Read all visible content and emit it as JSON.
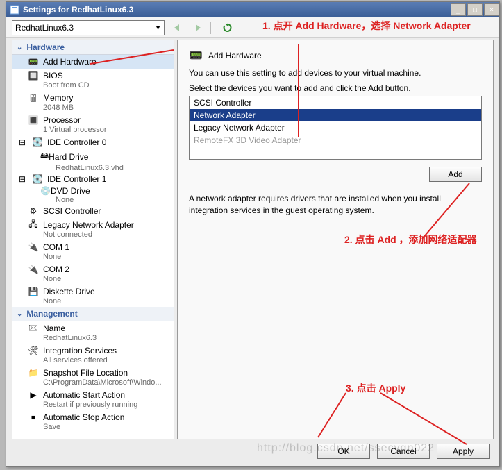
{
  "window": {
    "title": "Settings for RedhatLinux6.3"
  },
  "toolbar": {
    "vm_name": "RedhatLinux6.3"
  },
  "sections": {
    "hardware": "Hardware",
    "management": "Management"
  },
  "hw": {
    "add": {
      "label": "Add Hardware"
    },
    "bios": {
      "label": "BIOS",
      "sub": "Boot from CD"
    },
    "memory": {
      "label": "Memory",
      "sub": "2048 MB"
    },
    "processor": {
      "label": "Processor",
      "sub": "1 Virtual processor"
    },
    "ide0": {
      "label": "IDE Controller 0",
      "child": {
        "label": "Hard Drive",
        "sub": "RedhatLinux6.3.vhd"
      }
    },
    "ide1": {
      "label": "IDE Controller 1",
      "child": {
        "label": "DVD Drive",
        "sub": "None"
      }
    },
    "scsi": {
      "label": "SCSI Controller"
    },
    "legacy": {
      "label": "Legacy Network Adapter",
      "sub": "Not connected"
    },
    "com1": {
      "label": "COM 1",
      "sub": "None"
    },
    "com2": {
      "label": "COM 2",
      "sub": "None"
    },
    "diskette": {
      "label": "Diskette Drive",
      "sub": "None"
    }
  },
  "mg": {
    "name": {
      "label": "Name",
      "sub": "RedhatLinux6.3"
    },
    "integ": {
      "label": "Integration Services",
      "sub": "All services offered"
    },
    "snap": {
      "label": "Snapshot File Location",
      "sub": "C:\\ProgramData\\Microsoft\\Windo..."
    },
    "astart": {
      "label": "Automatic Start Action",
      "sub": "Restart if previously running"
    },
    "astop": {
      "label": "Automatic Stop Action",
      "sub": "Save"
    }
  },
  "main": {
    "title": "Add Hardware",
    "desc1": "You can use this setting to add devices to your virtual machine.",
    "desc2": "Select the devices you want to add and click the Add button.",
    "devices": {
      "d0": "SCSI Controller",
      "d1": "Network Adapter",
      "d2": "Legacy Network Adapter",
      "d3": "RemoteFX 3D Video Adapter"
    },
    "add_btn": "Add",
    "info": "A network adapter requires drivers that are installed when you install integration services in the guest operating system."
  },
  "footer": {
    "ok": "OK",
    "cancel": "Cancel",
    "apply": "Apply"
  },
  "anno": {
    "a1": "1. 点开 Add Hardware，选择 Network Adapter",
    "a2": "2. 点击 Add ，添加网络适配器",
    "a3": "3. 点击 Apply"
  },
  "watermark": "http://blog.csdn.net/ssecyqp022"
}
